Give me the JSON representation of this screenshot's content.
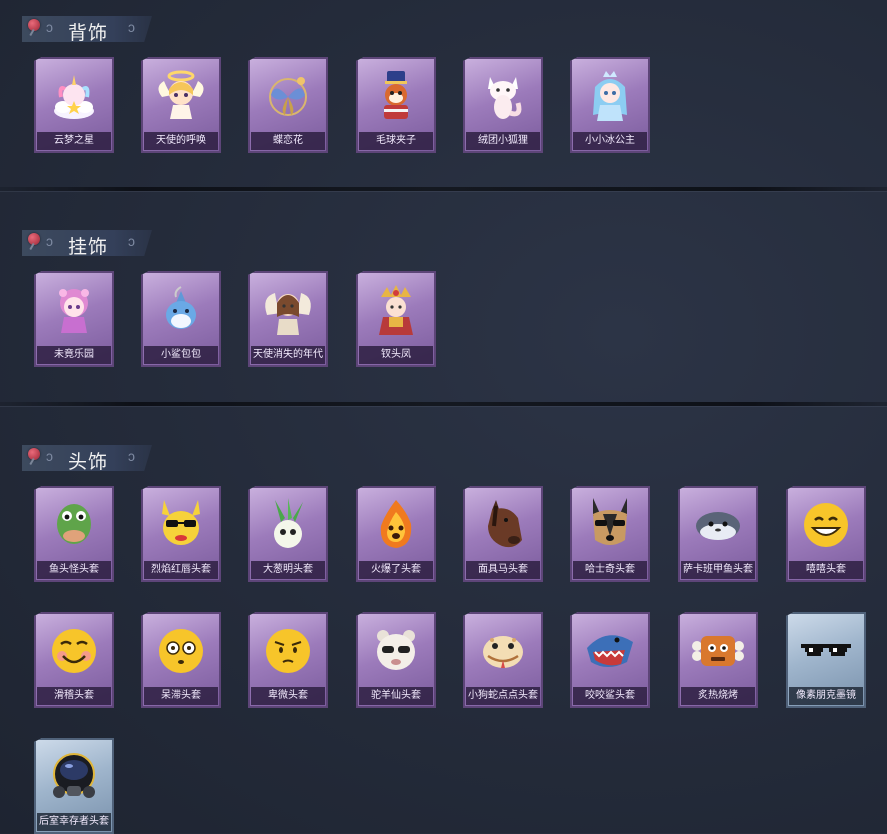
{
  "sections": [
    {
      "title": "背饰",
      "items": [
        {
          "name": "云梦之星",
          "icon": "unicorn-cloud-icon"
        },
        {
          "name": "天使的呼唤",
          "icon": "angel-doll-icon"
        },
        {
          "name": "蝶恋花",
          "icon": "butterfly-flower-icon"
        },
        {
          "name": "毛球夹子",
          "icon": "raccoon-soldier-icon"
        },
        {
          "name": "绒团小狐狸",
          "icon": "white-fox-icon"
        },
        {
          "name": "小小冰公主",
          "icon": "ice-princess-icon"
        }
      ]
    },
    {
      "title": "挂饰",
      "items": [
        {
          "name": "未竟乐园",
          "icon": "pink-girl-icon"
        },
        {
          "name": "小鲨包包",
          "icon": "shark-bag-icon"
        },
        {
          "name": "天使消失的年代",
          "icon": "angel-girl-icon"
        },
        {
          "name": "钗头凤",
          "icon": "phoenix-crown-icon"
        }
      ]
    },
    {
      "title": "头饰",
      "items": [
        {
          "name": "鱼头怪头套",
          "icon": "fish-head-icon"
        },
        {
          "name": "烈焰红唇头套",
          "icon": "pikachu-sunglasses-icon"
        },
        {
          "name": "大葱明头套",
          "icon": "scallion-icon"
        },
        {
          "name": "火爆了头套",
          "icon": "fire-spirit-icon"
        },
        {
          "name": "面具马头套",
          "icon": "horse-head-icon"
        },
        {
          "name": "哈士奇头套",
          "icon": "husky-sunglasses-icon"
        },
        {
          "name": "萨卡班甲鱼头套",
          "icon": "sacabambaspis-icon"
        },
        {
          "name": "嘻嘻头套",
          "icon": "grin-emoji-icon"
        },
        {
          "name": "滑稽头套",
          "icon": "funny-emoji-icon"
        },
        {
          "name": "呆滞头套",
          "icon": "dazed-emoji-icon"
        },
        {
          "name": "卑微头套",
          "icon": "humble-emoji-icon"
        },
        {
          "name": "驼羊仙头套",
          "icon": "alpaca-sunglasses-icon"
        },
        {
          "name": "小狗蛇点点头套",
          "icon": "snake-icon"
        },
        {
          "name": "咬咬鲨头套",
          "icon": "shark-head-icon"
        },
        {
          "name": "炙热烧烤",
          "icon": "bbq-meat-icon"
        },
        {
          "name": "像素朋克墨镜",
          "icon": "pixel-sunglasses-icon"
        },
        {
          "name": "后室幸存者头套",
          "icon": "gas-mask-helmet-icon"
        }
      ]
    }
  ],
  "colors": {
    "background": "#262d3c",
    "card_purple": "#9c7bbb",
    "card_blue": "#9fb5cc",
    "label_bg": "#2d1e41",
    "label_text": "#f4ecff",
    "pin": "#c8404f"
  }
}
